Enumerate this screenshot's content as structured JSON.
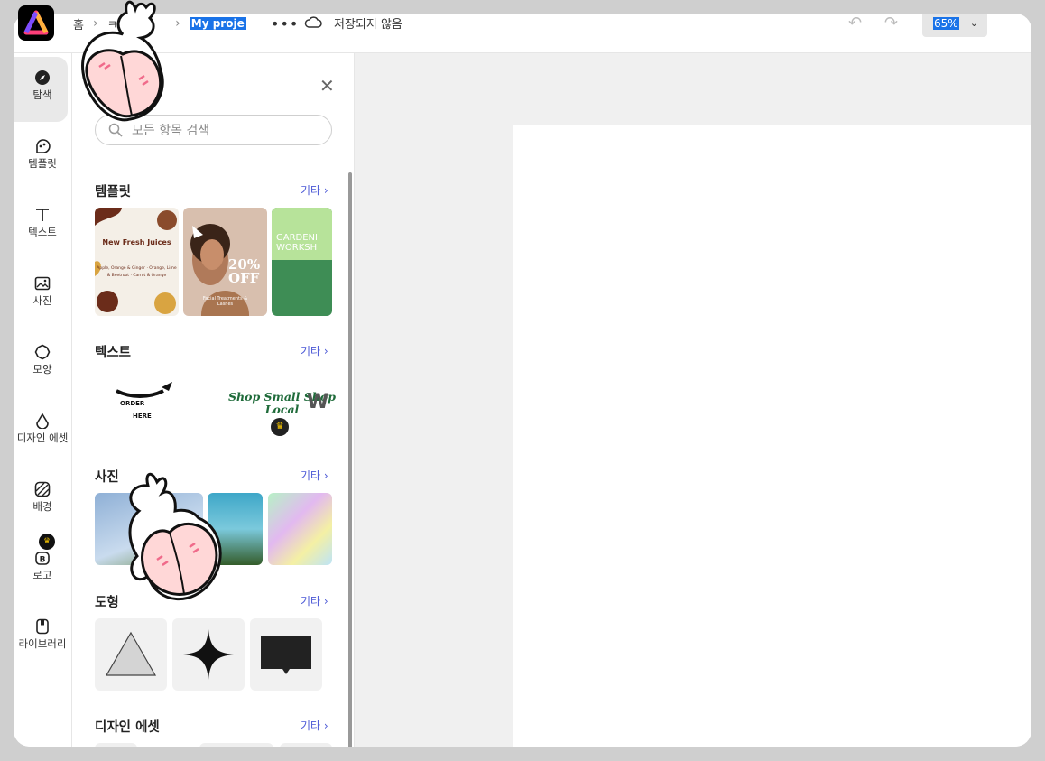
{
  "breadcrumbs": {
    "home": "홈",
    "item2": "ㅋ",
    "project": "My proje"
  },
  "topbar": {
    "more": "•••",
    "save_state": "저장되지 않음",
    "zoom": "65%"
  },
  "rail": [
    {
      "label": "탐색",
      "icon": "explore-icon"
    },
    {
      "label": "템플릿",
      "icon": "templates-icon"
    },
    {
      "label": "텍스트",
      "icon": "text-icon"
    },
    {
      "label": "사진",
      "icon": "photo-icon"
    },
    {
      "label": "모양",
      "icon": "shape-icon"
    },
    {
      "label": "디자인 에셋",
      "icon": "design-assets-icon"
    },
    {
      "label": "배경",
      "icon": "background-icon"
    },
    {
      "label": "로고",
      "icon": "logo-icon"
    },
    {
      "label": "라이브러리",
      "icon": "library-icon"
    }
  ],
  "panel": {
    "search_placeholder": "모든 항목 검색",
    "sections": [
      {
        "title": "템플릿",
        "more": "기타 ›"
      },
      {
        "title": "텍스트",
        "more": "기타 ›"
      },
      {
        "title": "사진",
        "more": "기타 ›"
      },
      {
        "title": "도형",
        "more": "기타 ›"
      },
      {
        "title": "디자인 에셋",
        "more": "기타 ›"
      }
    ],
    "templates": {
      "t1_title": "New Fresh Juices",
      "t1_text": "Apple, Orange & Ginger · Orange, Lime & Beetroot · Carrot & Orange",
      "t2_big": "20% OFF",
      "t2_foot": "Facial Treatments & Lashes",
      "t3_title": "GARDENI WORKSH"
    },
    "text_samples": {
      "order": "ORDER HERE",
      "shop": "Shop Small Shop Local",
      "w": "W"
    }
  },
  "colors": {
    "accent": "#1a73e8",
    "link": "#4b58d6",
    "crown": "#f5c400"
  }
}
